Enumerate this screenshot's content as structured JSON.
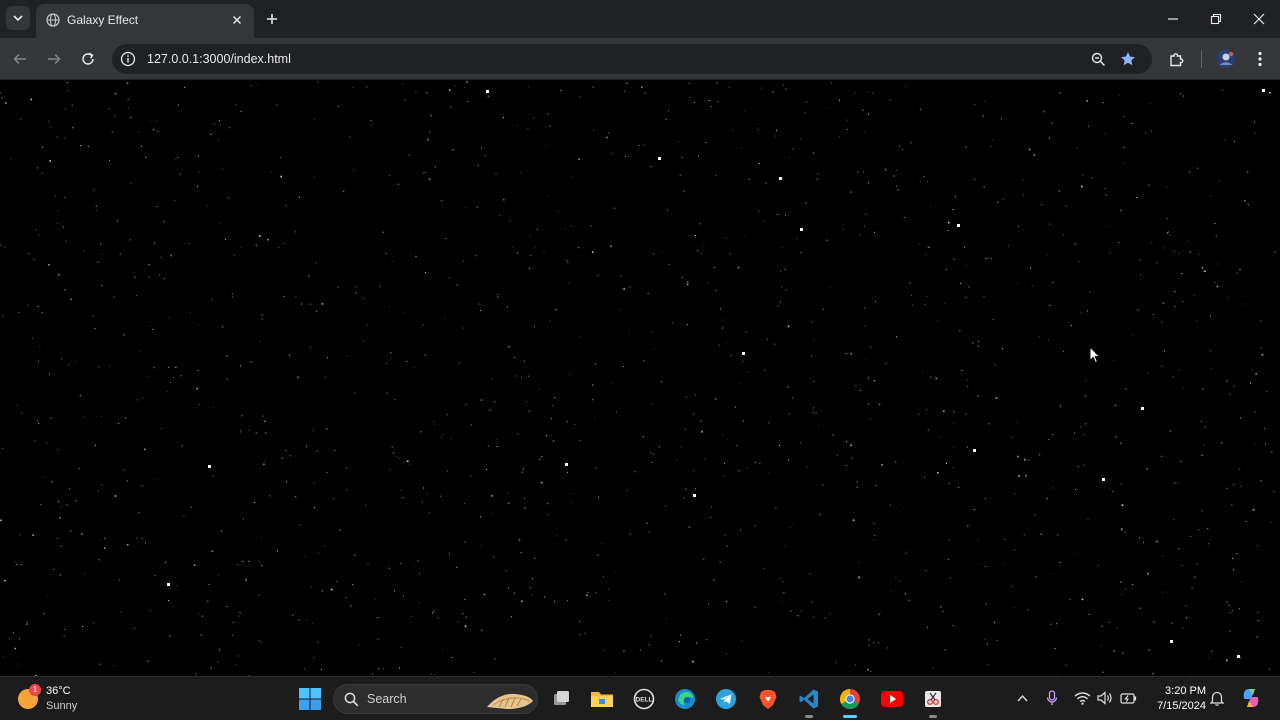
{
  "browser": {
    "tab_title": "Galaxy Effect",
    "url": "127.0.0.1:3000/index.html"
  },
  "icons": {
    "tab_search": "chevron-down-icon",
    "favicon": "globe-icon",
    "tab_close": "close-icon",
    "new_tab": "plus-icon",
    "back": "arrow-left-icon",
    "forward": "arrow-right-icon",
    "reload": "reload-icon",
    "site_info": "info-icon",
    "zoom": "zoom-icon",
    "bookmark": "star-icon",
    "extensions": "puzzle-icon",
    "profile": "avatar-icon",
    "menu": "kebab-menu-icon"
  },
  "colors": {
    "page_background": "#000000",
    "star": "#ffffff",
    "bookmark_star": "#8ab4f8",
    "accent": "#60cdff"
  },
  "taskbar": {
    "weather": {
      "temp": "36°C",
      "condition": "Sunny",
      "badge": "1"
    },
    "search_label": "Search",
    "apps": [
      "task-view",
      "file-explorer",
      "dell",
      "edge",
      "telegram",
      "brave",
      "vscode",
      "chrome",
      "youtube",
      "snipping-tool"
    ],
    "clock": {
      "time": "3:20 PM",
      "date": "7/15/2024"
    }
  }
}
